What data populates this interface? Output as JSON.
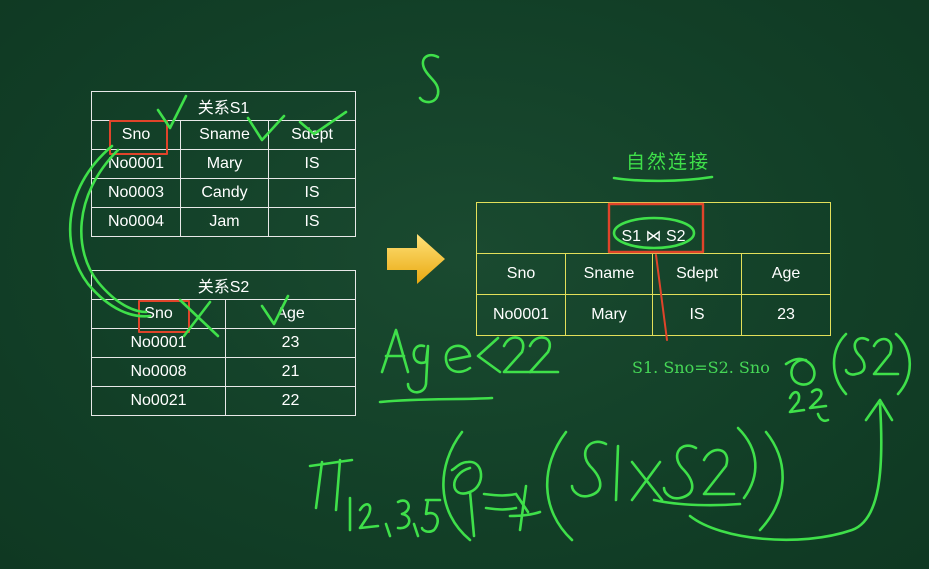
{
  "relation_s1": {
    "caption": "关系S1",
    "headers": [
      "Sno",
      "Sname",
      "Sdept"
    ],
    "rows": [
      [
        "No0001",
        "Mary",
        "IS"
      ],
      [
        "No0003",
        "Candy",
        "IS"
      ],
      [
        "No0004",
        "Jam",
        "IS"
      ]
    ]
  },
  "relation_s2": {
    "caption": "关系S2",
    "headers": [
      "Sno",
      "Age"
    ],
    "rows": [
      [
        "No0001",
        "23"
      ],
      [
        "No0008",
        "21"
      ],
      [
        "No0021",
        "22"
      ]
    ]
  },
  "result": {
    "heading": "S1 ⋈ S2",
    "headers": [
      "Sno",
      "Sname",
      "Sdept",
      "Age"
    ],
    "rows": [
      [
        "No0001",
        "Mary",
        "IS",
        "23"
      ]
    ]
  },
  "annotations": {
    "natural_join_title": "自然连接",
    "join_condition": "S1. Sno=S2. Sno"
  },
  "colors": {
    "board": "#123f27",
    "chalk_green": "#3fe04a",
    "table_line": "#e8e8e8",
    "result_line": "#e3df5a",
    "highlight_red": "#e0442a",
    "arrow_yellow": "#f2c21b"
  }
}
